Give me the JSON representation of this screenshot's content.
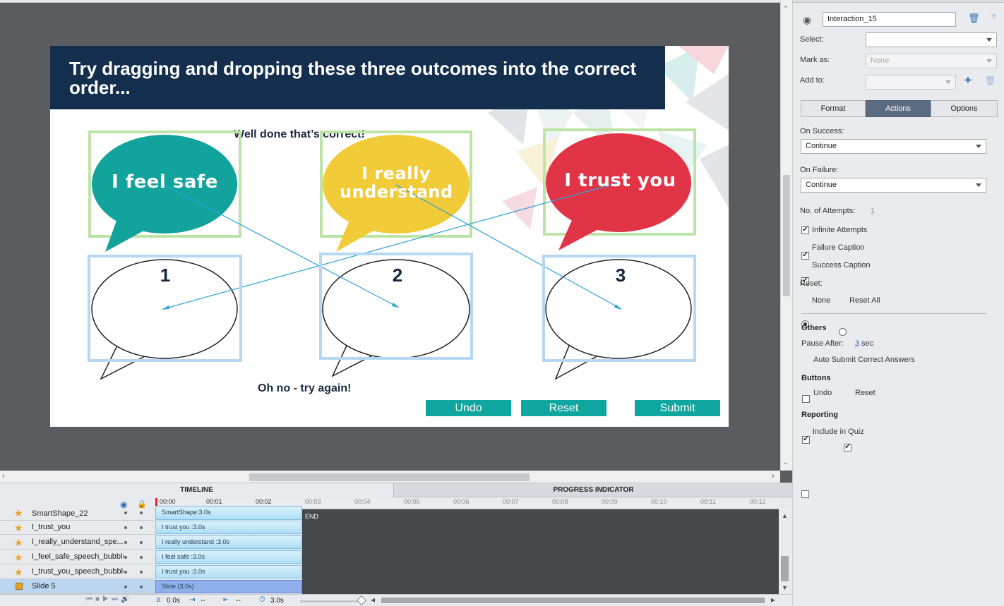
{
  "slide": {
    "title": "Try dragging and dropping these three outcomes into the correct order...",
    "success_caption": "Well done that’s correct!",
    "failure_caption": "Oh no - try again!",
    "bubbles": [
      {
        "text": "I feel safe",
        "color": "#12a39d"
      },
      {
        "text": "I really understand",
        "color": "#f2cb39"
      },
      {
        "text": "I trust you",
        "color": "#e23447"
      }
    ],
    "targets": [
      "1",
      "2",
      "3"
    ],
    "buttons": {
      "undo": "Undo",
      "reset": "Reset",
      "submit": "Submit"
    }
  },
  "panel": {
    "name_value": "Interaction_15",
    "select_label": "Select:",
    "select_value": "",
    "markas_label": "Mark as:",
    "markas_value": "None",
    "addto_label": "Add to:",
    "addto_value": "",
    "tabs": [
      "Format",
      "Actions",
      "Options"
    ],
    "on_success_label": "On Success:",
    "on_success_value": "Continue",
    "on_failure_label": "On Failure:",
    "on_failure_value": "Continue",
    "attempts_label": "No. of Attempts:",
    "attempts_value": "1",
    "infinite_attempts": "Infinite Attempts",
    "failure_caption": "Failure Caption",
    "success_caption": "Success Caption",
    "reset_label": "Reset:",
    "reset_none": "None",
    "reset_all": "Reset All",
    "others_heading": "Others",
    "pause_after_label": "Pause After:",
    "pause_after_value": "3",
    "pause_after_unit": "sec",
    "auto_submit": "Auto Submit Correct Answers",
    "buttons_heading": "Buttons",
    "undo": "Undo",
    "reset": "Reset",
    "reporting_heading": "Reporting",
    "include_quiz": "Include in Quiz"
  },
  "timeline": {
    "tabs": [
      "TIMELINE",
      "PROGRESS INDICATOR"
    ],
    "ruler": [
      "00:00",
      "00:01",
      "00:02",
      "00:03",
      "00:04",
      "00:05",
      "00:06",
      "00:07",
      "00:08",
      "00:09",
      "00:10",
      "00:11",
      "00:12"
    ],
    "end_label": "END",
    "layers": [
      {
        "name": "SmartShape_22",
        "bar": "SmartShape:3.0s"
      },
      {
        "name": "I_trust_you",
        "bar": "I trust you :3.0s"
      },
      {
        "name": "I_really_understand_spe...",
        "bar": "I really understand :3.0s"
      },
      {
        "name": "I_feel_safe_speech_bubble",
        "bar": "I feel safe :3.0s"
      },
      {
        "name": "I_trust_you_speech_bubble",
        "bar": "I trust you :3.0s"
      },
      {
        "name": "Slide 5",
        "bar": "Slide (3.0s)"
      }
    ],
    "footer": {
      "time": "0.0s",
      "in": "--",
      "out": "--",
      "duration": "3.0s"
    }
  }
}
